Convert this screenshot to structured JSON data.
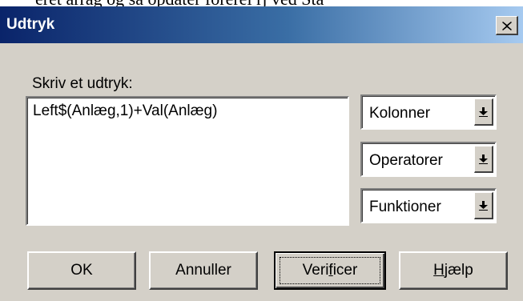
{
  "background_text": "eret arrag og sa opdater forerel rj ved Sta",
  "window": {
    "title": "Udtryk",
    "close_label": "✕"
  },
  "prompt_label": "Skriv et udtryk:",
  "expression": "Left$(Anlæg,1)+Val(Anlæg)",
  "dropdowns": [
    {
      "label": "Kolonner"
    },
    {
      "label": "Operatorer"
    },
    {
      "label": "Funktioner"
    }
  ],
  "buttons": {
    "ok": "OK",
    "cancel": "Annuller",
    "verify_pre": "Veri",
    "verify_accel": "f",
    "verify_post": "icer",
    "help_accel": "H",
    "help_post": "jælp"
  },
  "colors": {
    "titlebar_start": "#0a246a",
    "titlebar_end": "#a6caf0",
    "face": "#d4d0c8"
  },
  "icons": {
    "close": "close-icon",
    "dropdown": "dropdown-arrow-icon"
  }
}
